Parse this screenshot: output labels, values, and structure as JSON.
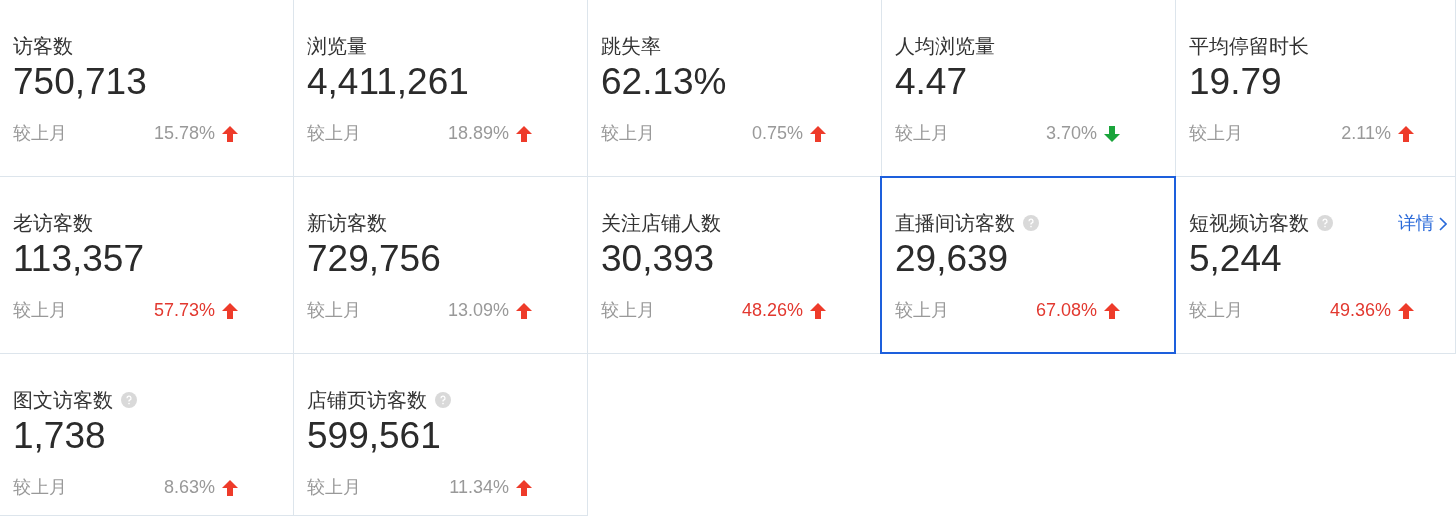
{
  "cards": [
    {
      "title": "访客数",
      "value": "750,713",
      "compare_label": "较上月",
      "change": "15.78%",
      "rising": true,
      "emphasized": false,
      "help_icon": false,
      "selected": false
    },
    {
      "title": "浏览量",
      "value": "4,411,261",
      "compare_label": "较上月",
      "change": "18.89%",
      "rising": true,
      "emphasized": false,
      "help_icon": false,
      "selected": false
    },
    {
      "title": "跳失率",
      "value": "62.13%",
      "compare_label": "较上月",
      "change": "0.75%",
      "rising": true,
      "emphasized": false,
      "help_icon": false,
      "selected": false
    },
    {
      "title": "人均浏览量",
      "value": "4.47",
      "compare_label": "较上月",
      "change": "3.70%",
      "rising": false,
      "emphasized": false,
      "help_icon": false,
      "selected": false
    },
    {
      "title": "平均停留时长",
      "value": "19.79",
      "compare_label": "较上月",
      "change": "2.11%",
      "rising": true,
      "emphasized": false,
      "help_icon": false,
      "selected": false
    },
    {
      "title": "老访客数",
      "value": "113,357",
      "compare_label": "较上月",
      "change": "57.73%",
      "rising": true,
      "emphasized": true,
      "help_icon": false,
      "selected": false
    },
    {
      "title": "新访客数",
      "value": "729,756",
      "compare_label": "较上月",
      "change": "13.09%",
      "rising": true,
      "emphasized": false,
      "help_icon": false,
      "selected": false
    },
    {
      "title": "关注店铺人数",
      "value": "30,393",
      "compare_label": "较上月",
      "change": "48.26%",
      "rising": true,
      "emphasized": true,
      "help_icon": false,
      "selected": false
    },
    {
      "title": "直播间访客数",
      "value": "29,639",
      "compare_label": "较上月",
      "change": "67.08%",
      "rising": true,
      "emphasized": true,
      "help_icon": true,
      "selected": true
    },
    {
      "title": "短视频访客数",
      "value": "5,244",
      "compare_label": "较上月",
      "change": "49.36%",
      "rising": true,
      "emphasized": true,
      "help_icon": true,
      "selected": false,
      "link": "详情"
    },
    {
      "title": "图文访客数",
      "value": "1,738",
      "compare_label": "较上月",
      "change": "8.63%",
      "rising": true,
      "emphasized": false,
      "help_icon": true,
      "selected": false
    },
    {
      "title": "店铺页访客数",
      "value": "599,561",
      "compare_label": "较上月",
      "change": "11.34%",
      "rising": true,
      "emphasized": false,
      "help_icon": true,
      "selected": false
    }
  ]
}
